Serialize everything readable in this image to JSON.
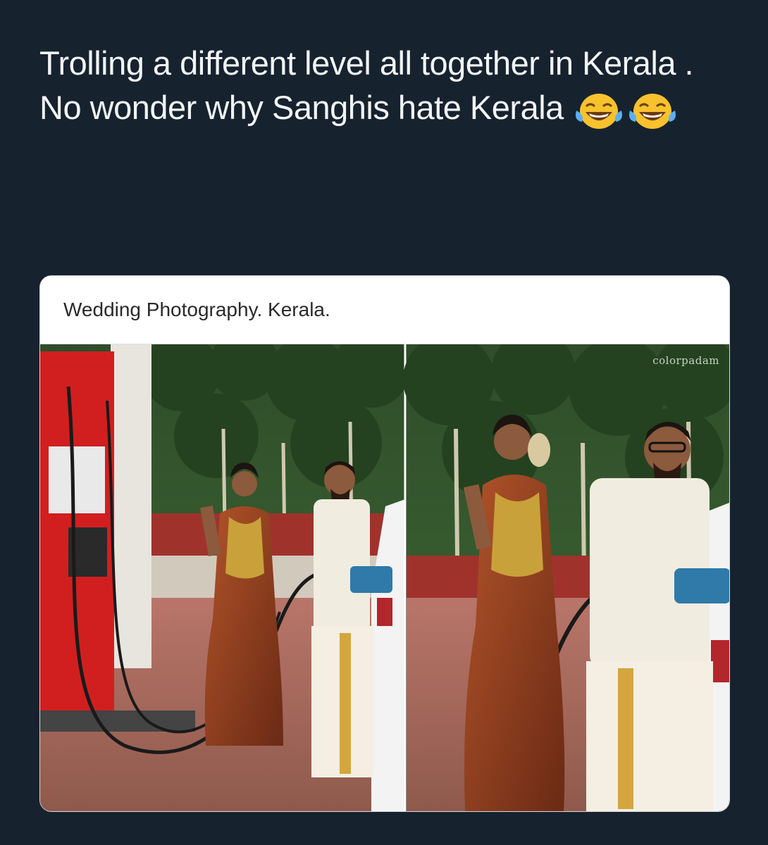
{
  "post": {
    "caption_text": "Trolling a different level all together in Kerala . No wonder why Sanghis hate Kerala",
    "emojis": [
      "face-with-tears-of-joy-icon",
      "face-with-tears-of-joy-icon"
    ]
  },
  "card": {
    "header_text": "Wedding Photography. Kerala.",
    "watermark": "colorpadam"
  },
  "colors": {
    "background": "#17222f",
    "caption_text": "#f2f4f6",
    "card_background": "#ffffff",
    "saree": "#8a3a1c",
    "fuel_pump": "#d11f1f"
  }
}
